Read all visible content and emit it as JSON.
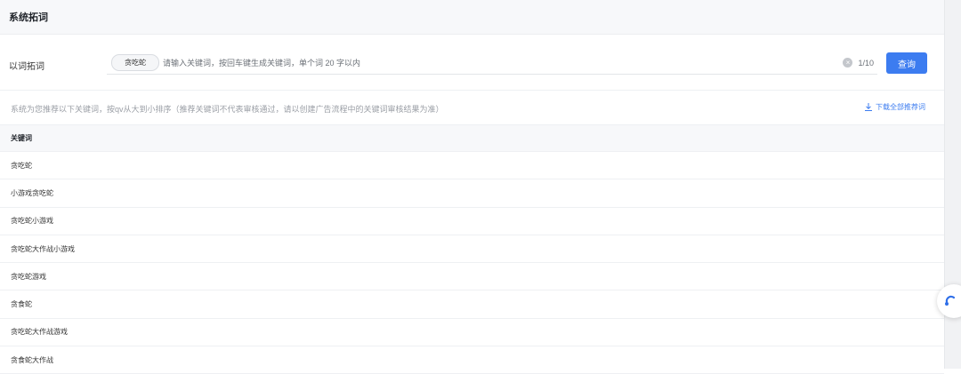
{
  "header": {
    "title": "系统拓词"
  },
  "search": {
    "label": "以词拓词",
    "tag": "贪吃蛇",
    "placeholder": "请输入关键词，按回车键生成关键词，单个词 20 字以内",
    "counter": "1/10",
    "query_label": "查询"
  },
  "hint": {
    "text": "系统为您推荐以下关键词，按qv从大到小排序（推荐关键词不代表审核通过，请以创建广告流程中的关键词审核结果为准）",
    "download_label": "下载全部推荐词"
  },
  "table": {
    "header": "关键词",
    "rows": [
      "贪吃蛇",
      "小游戏贪吃蛇",
      "贪吃蛇小游戏",
      "贪吃蛇大作战小游戏",
      "贪吃蛇游戏",
      "贪食蛇",
      "贪吃蛇大作战游戏",
      "贪食蛇大作战"
    ]
  },
  "colors": {
    "accent": "#3c7cf0"
  },
  "icons": {
    "clear": "clear-icon",
    "download": "download-icon",
    "widget": "support-icon"
  }
}
